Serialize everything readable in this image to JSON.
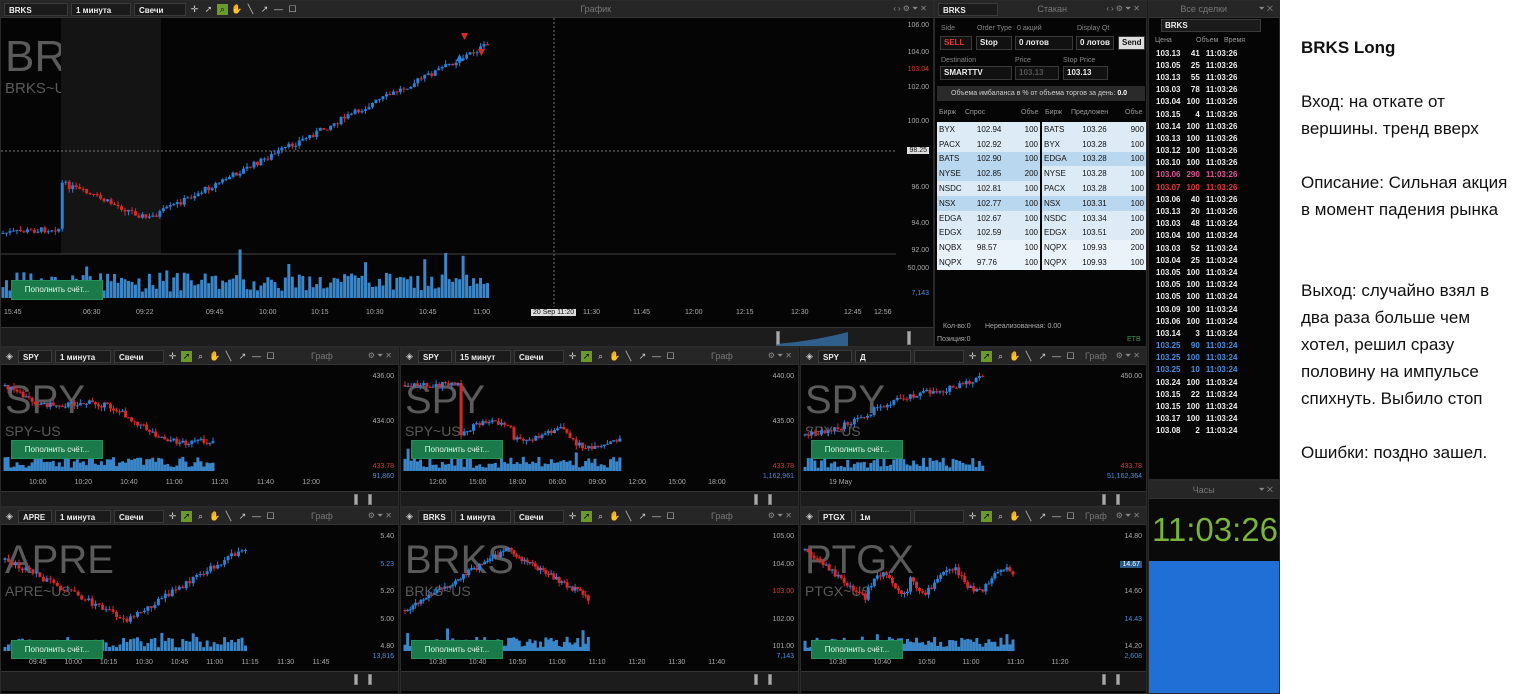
{
  "main_chart": {
    "symbol": "BRKS",
    "interval": "1 минута",
    "chart_type": "Свечи",
    "title": "График",
    "watermark": "BRKS",
    "watermark_sub": "BRKS~US",
    "y_ticks": [
      "106.00",
      "104.00",
      "103.04",
      "102.00",
      "100.00",
      "98.25",
      "96.00",
      "94.00",
      "92.00",
      "50,000",
      "7,143"
    ],
    "x_ticks": [
      "15:45",
      "06:30",
      "09:22",
      "09:45",
      "10:00",
      "10:15",
      "10:30",
      "10:45",
      "11:00",
      "20 Sep 11:20",
      "11:30",
      "11:45",
      "12:00",
      "12:15",
      "12:30",
      "12:45",
      "12:56"
    ],
    "deposit_btn": "Пополнить счёт..."
  },
  "dom": {
    "symbol": "BRKS",
    "title": "Стакан",
    "labels": {
      "side": "Side",
      "order_type": "Order Type",
      "shares": "0 акций",
      "display": "Display Qt",
      "destination": "Destination",
      "price": "Price",
      "stop_price": "Stop Price"
    },
    "side": "SELL",
    "order_type": "Stop",
    "lots1": "0 лотов",
    "lots2": "0 лотов",
    "send": "Send",
    "destination": "SMARTTV",
    "price": "103.13",
    "stop_price": "103.13",
    "imbalance": "Объема имбаланса в % от объема торгов за день:",
    "imbalance_val": "0.0",
    "headers": [
      "Бирж",
      "Спрос",
      "Объе",
      "Бирж",
      "Предложен",
      "Объе"
    ],
    "bids": [
      [
        "BYX",
        "102.94",
        "100"
      ],
      [
        "PACX",
        "102.92",
        "100"
      ],
      [
        "BATS",
        "102.90",
        "100"
      ],
      [
        "NYSE",
        "102.85",
        "200"
      ],
      [
        "NSDC",
        "102.81",
        "100"
      ],
      [
        "NSX",
        "102.77",
        "100"
      ],
      [
        "EDGA",
        "102.67",
        "100"
      ],
      [
        "EDGX",
        "102.59",
        "100"
      ],
      [
        "NQBX",
        "98.57",
        "100"
      ],
      [
        "NQPX",
        "97.76",
        "100"
      ]
    ],
    "asks": [
      [
        "BATS",
        "103.26",
        "900"
      ],
      [
        "BYX",
        "103.28",
        "100"
      ],
      [
        "EDGA",
        "103.28",
        "100"
      ],
      [
        "NYSE",
        "103.28",
        "100"
      ],
      [
        "PACX",
        "103.28",
        "100"
      ],
      [
        "NSX",
        "103.31",
        "100"
      ],
      [
        "NSDC",
        "103.34",
        "100"
      ],
      [
        "EDGX",
        "103.51",
        "200"
      ],
      [
        "NQPX",
        "109.93",
        "200"
      ],
      [
        "NQPX",
        "109.93",
        "100"
      ]
    ],
    "qty": "Кол-во:0",
    "unrealized": "Нереализованная: 0.00",
    "position": "Позиция:0",
    "etb": "ETB"
  },
  "trades": {
    "title": "Все сделки",
    "symbol": "BRKS",
    "headers": [
      "Цена",
      "Объем",
      "Время"
    ],
    "rows": [
      [
        "103.13",
        "41",
        "11:03:26",
        "w"
      ],
      [
        "103.05",
        "25",
        "11:03:26",
        "w"
      ],
      [
        "103.13",
        "55",
        "11:03:26",
        "w"
      ],
      [
        "103.03",
        "78",
        "11:03:26",
        "w"
      ],
      [
        "103.04",
        "100",
        "11:03:26",
        "w"
      ],
      [
        "103.15",
        "4",
        "11:03:26",
        "w"
      ],
      [
        "103.14",
        "100",
        "11:03:26",
        "w"
      ],
      [
        "103.13",
        "100",
        "11:03:26",
        "w"
      ],
      [
        "103.12",
        "100",
        "11:03:26",
        "w"
      ],
      [
        "103.10",
        "100",
        "11:03:26",
        "w"
      ],
      [
        "103.06",
        "290",
        "11:03:26",
        "p"
      ],
      [
        "103.07",
        "100",
        "11:03:26",
        "r"
      ],
      [
        "103.06",
        "40",
        "11:03:26",
        "w"
      ],
      [
        "103.13",
        "20",
        "11:03:26",
        "w"
      ],
      [
        "103.03",
        "48",
        "11:03:24",
        "w"
      ],
      [
        "103.04",
        "100",
        "11:03:24",
        "w"
      ],
      [
        "103.03",
        "52",
        "11:03:24",
        "w"
      ],
      [
        "103.04",
        "25",
        "11:03:24",
        "w"
      ],
      [
        "103.05",
        "100",
        "11:03:24",
        "w"
      ],
      [
        "103.05",
        "100",
        "11:03:24",
        "w"
      ],
      [
        "103.05",
        "100",
        "11:03:24",
        "w"
      ],
      [
        "103.09",
        "100",
        "11:03:24",
        "w"
      ],
      [
        "103.06",
        "100",
        "11:03:24",
        "w"
      ],
      [
        "103.14",
        "3",
        "11:03:24",
        "w"
      ],
      [
        "103.25",
        "90",
        "11:03:24",
        "b"
      ],
      [
        "103.25",
        "100",
        "11:03:24",
        "b"
      ],
      [
        "103.25",
        "10",
        "11:03:24",
        "b"
      ],
      [
        "103.24",
        "100",
        "11:03:24",
        "w"
      ],
      [
        "103.15",
        "22",
        "11:03:24",
        "w"
      ],
      [
        "103.15",
        "100",
        "11:03:24",
        "w"
      ],
      [
        "103.17",
        "100",
        "11:03:24",
        "w"
      ],
      [
        "103.08",
        "2",
        "11:03:24",
        "w"
      ]
    ],
    "colors": {
      "w": "#eeeeee",
      "p": "#e0559a",
      "r": "#e03838",
      "b": "#4a8fe0"
    }
  },
  "clock": {
    "title": "Часы",
    "time": "11:03:26"
  },
  "small_charts": [
    {
      "symbol": "SPY",
      "interval": "1 минута",
      "type": "Свечи",
      "title": "Граф",
      "wm": "SPY",
      "wm_sub": "SPY~US",
      "y": [
        "436.00",
        "434.00",
        "433.78"
      ],
      "x": [
        "10:00",
        "10:20",
        "10:40",
        "11:00",
        "11:20",
        "11:40",
        "12:00"
      ],
      "vol": "91,860",
      "btn": "Пополнить счёт..."
    },
    {
      "symbol": "SPY",
      "interval": "15 минут",
      "type": "Свечи",
      "title": "Граф",
      "wm": "SPY",
      "wm_sub": "SPY~US",
      "y": [
        "440.00",
        "435.00",
        "433.78"
      ],
      "x": [
        "12:00",
        "15:00",
        "18:00",
        "06:00",
        "09:00",
        "12:00",
        "15:00",
        "18:00"
      ],
      "vol": "1,162,961",
      "btn": "Пополнить счёт..."
    },
    {
      "symbol": "SPY",
      "interval": "Д",
      "type": "",
      "title": "Граф",
      "wm": "SPY",
      "wm_sub": "SPY~US",
      "y": [
        "450.00",
        "433.78"
      ],
      "x": [
        "19 May"
      ],
      "vol": "51,162,364",
      "btn": "Пополнить счёт..."
    },
    {
      "symbol": "APRE",
      "interval": "1 минута",
      "type": "Свечи",
      "title": "Граф",
      "wm": "APRE",
      "wm_sub": "APRE~US",
      "y": [
        "5.40",
        "5.23",
        "5.20",
        "5.00",
        "4.80"
      ],
      "x": [
        "09:45",
        "10:00",
        "10:15",
        "10:30",
        "10:45",
        "11:00",
        "11:15",
        "11:30",
        "11:45"
      ],
      "vol": "13,816",
      "btn": "Пополнить счёт..."
    },
    {
      "symbol": "BRKS",
      "interval": "1 минута",
      "type": "Свечи",
      "title": "Граф",
      "wm": "BRKS",
      "wm_sub": "BRKS~US",
      "y": [
        "105.00",
        "104.00",
        "103.00",
        "102.00",
        "101.00"
      ],
      "x": [
        "10:30",
        "10:40",
        "10:50",
        "11:00",
        "11:10",
        "11:20",
        "11:30",
        "11:40"
      ],
      "vol": "7,143",
      "btn": "Пополнить счёт..."
    },
    {
      "symbol": "PTGX",
      "interval": "1м",
      "type": "",
      "title": "Граф",
      "wm": "PTGX",
      "wm_sub": "PTGX~US",
      "y": [
        "14.80",
        "14.67",
        "14.60",
        "14.43",
        "14.20"
      ],
      "x": [
        "10:30",
        "10:40",
        "10:50",
        "11:00",
        "11:10",
        "11:20"
      ],
      "vol": "2,608",
      "btn": "Пополнить счёт..."
    }
  ],
  "notes": {
    "title": "BRKS Long",
    "entry": "Вход: на откате от вершины. тренд вверх",
    "description": "Описание: Сильная акция в момент падения рынка",
    "exit": "Выход: случайно взял в два раза больше чем хотел, решил сразу половину на импульсе спихнуть. Выбило стоп",
    "errors": "Ошибки: поздно зашел."
  },
  "colors": {
    "up": "#2e7fd6",
    "down": "#d42a2a",
    "vol": "#3a86c8",
    "accent": "#1a7a4a"
  }
}
